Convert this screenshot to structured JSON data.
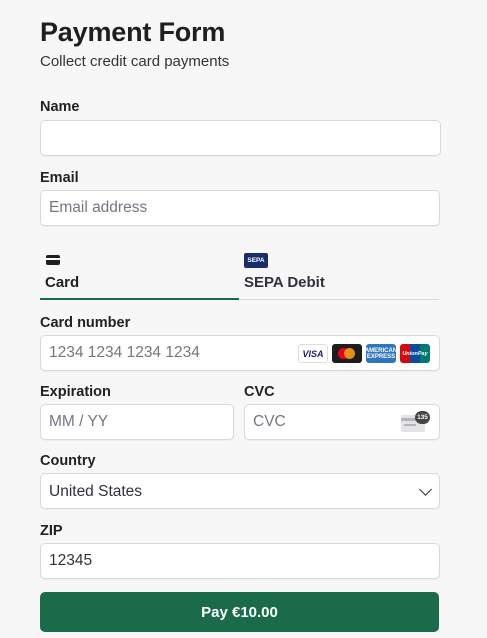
{
  "header": {
    "title": "Payment Form",
    "subtitle": "Collect credit card payments"
  },
  "name": {
    "label": "Name",
    "value": "",
    "placeholder": ""
  },
  "email": {
    "label": "Email",
    "value": "",
    "placeholder": "Email address"
  },
  "payment_tabs": [
    {
      "label": "Card",
      "icon": "card-icon",
      "selected": true
    },
    {
      "label": "SEPA Debit",
      "icon": "sepa-icon",
      "badge": "SEPA",
      "selected": false
    }
  ],
  "card_number": {
    "label": "Card number",
    "value": "",
    "placeholder": "1234 1234 1234 1234",
    "brands": [
      {
        "name": "visa-icon",
        "text": "VISA"
      },
      {
        "name": "mastercard-icon",
        "text": ""
      },
      {
        "name": "amex-icon",
        "text": "AMERICAN EXPRESS"
      },
      {
        "name": "unionpay-icon",
        "text": "UnionPay"
      }
    ]
  },
  "expiration": {
    "label": "Expiration",
    "value": "",
    "placeholder": "MM / YY"
  },
  "cvc": {
    "label": "CVC",
    "value": "",
    "placeholder": "CVC",
    "icon_text": "135"
  },
  "country": {
    "label": "Country",
    "selected": "United States"
  },
  "zip": {
    "label": "ZIP",
    "value": "12345",
    "placeholder": ""
  },
  "pay_button": {
    "label": "Pay €10.00"
  },
  "colors": {
    "accent": "#1a6b4a",
    "background": "#f7f7f7",
    "field_border": "#d9d9d9",
    "text": "#30313d"
  }
}
